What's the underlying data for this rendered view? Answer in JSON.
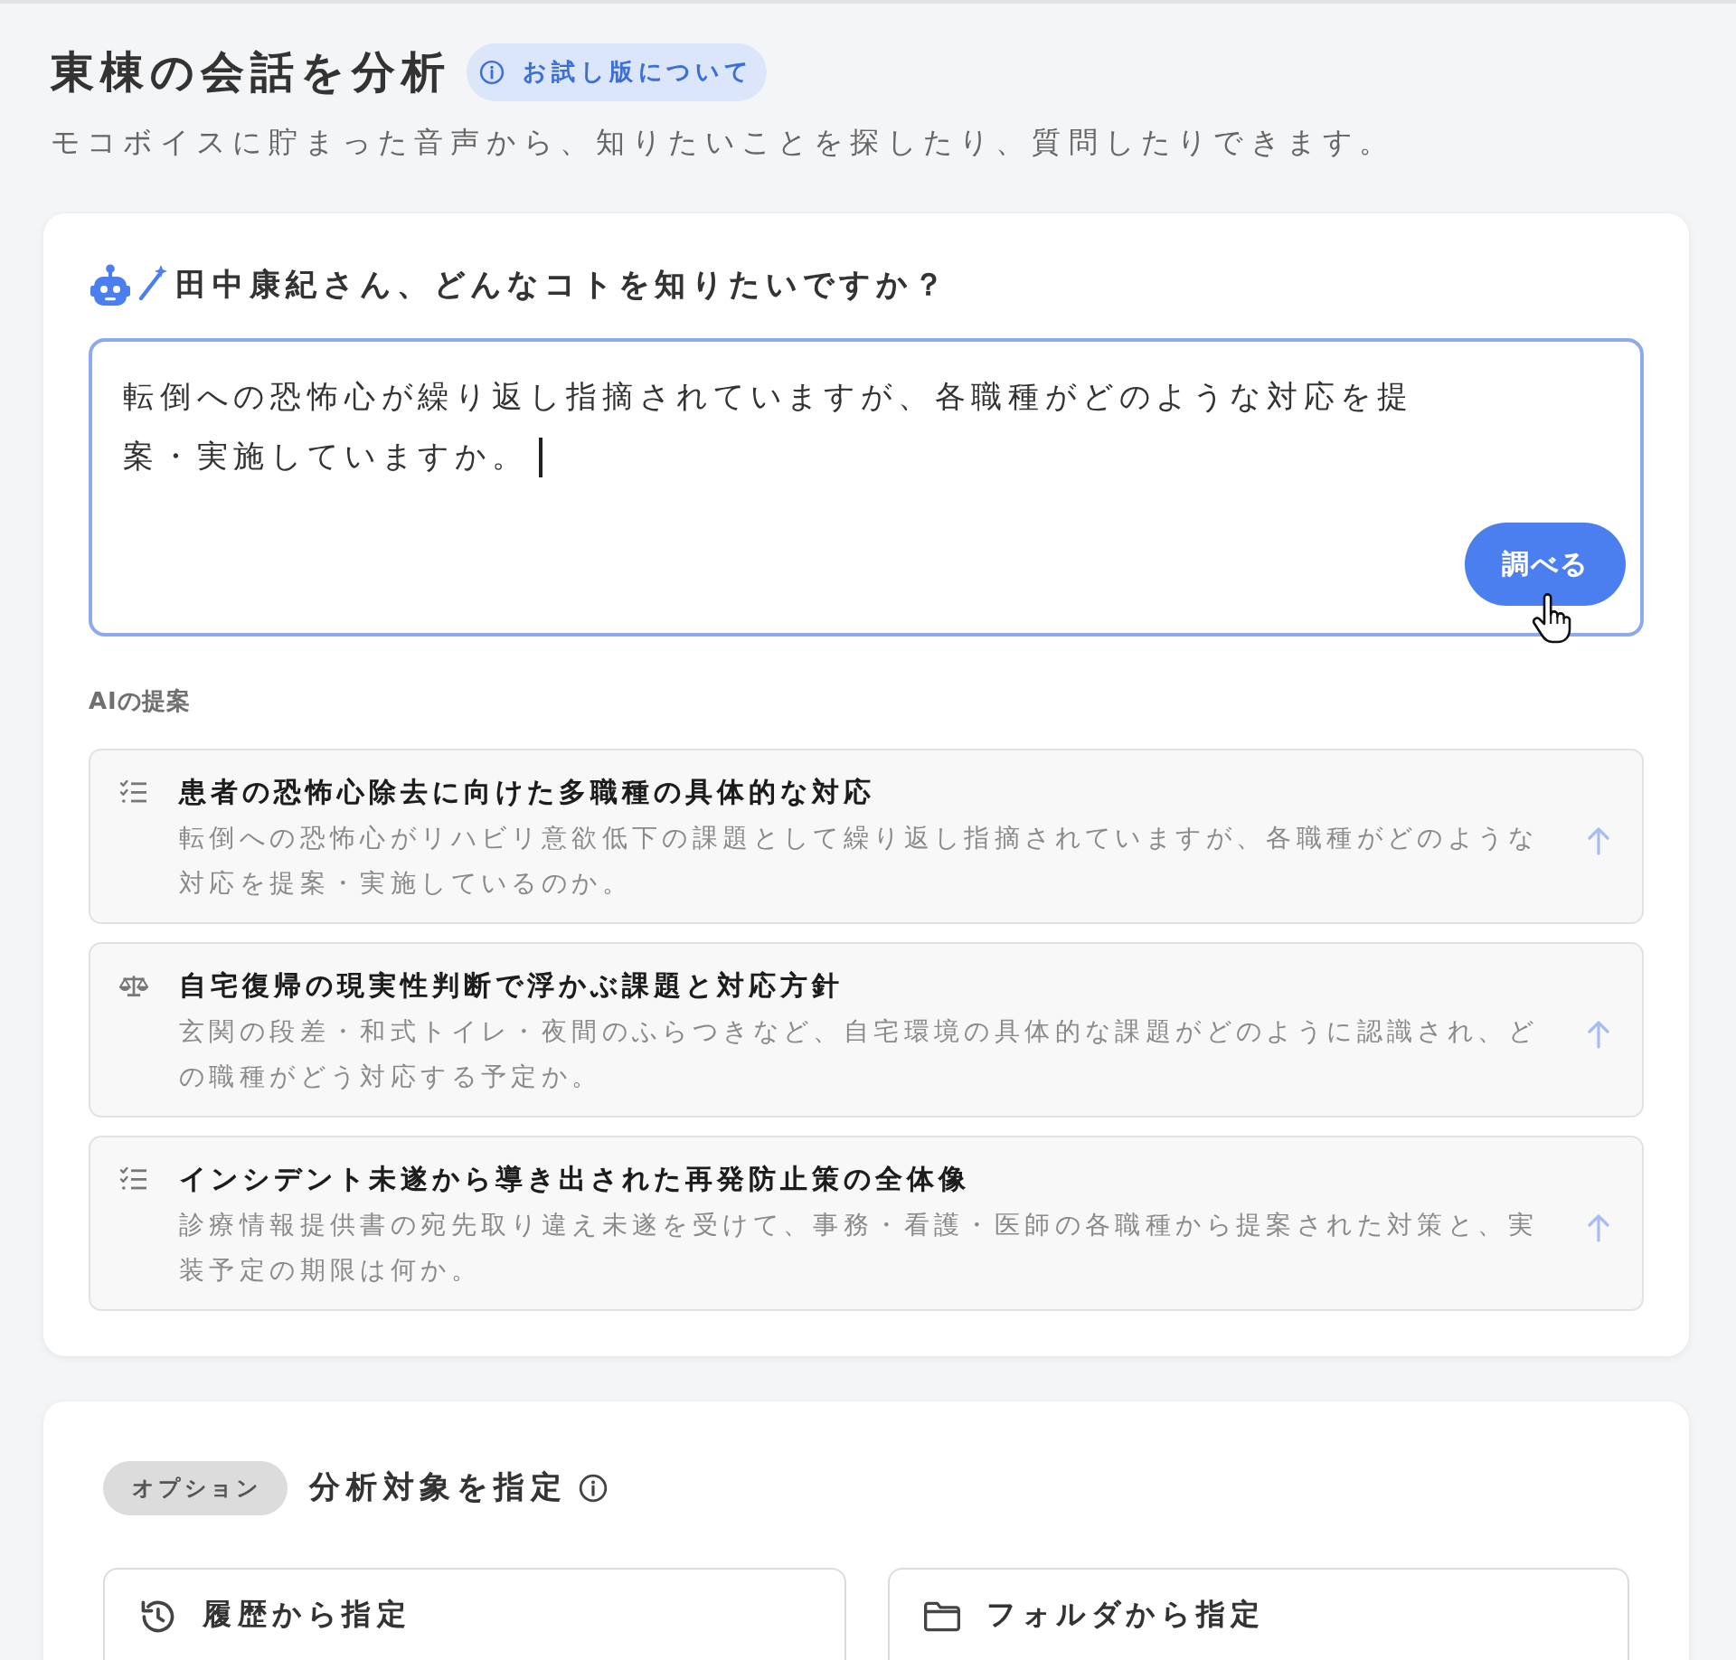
{
  "header": {
    "title": "東棟の会話を分析",
    "badge": "お試し版について",
    "subtitle": "モコボイスに貯まった音声から、知りたいことを探したり、質問したりできます。"
  },
  "question": {
    "prompt": "田中康紀さん、どんなコトを知りたいですか？",
    "value": "転倒への恐怖心が繰り返し指摘されていますが、各職種がどのような対応を提案・実施していますか。",
    "button": "調べる"
  },
  "suggestions": {
    "label": "AIの提案",
    "items": [
      {
        "kind": "checklist",
        "title": "患者の恐怖心除去に向けた多職種の具体的な対応",
        "description": "転倒への恐怖心がリハビリ意欲低下の課題として繰り返し指摘されていますが、各職種がどのような対応を提案・実施しているのか。"
      },
      {
        "kind": "balance",
        "title": "自宅復帰の現実性判断で浮かぶ課題と対応方針",
        "description": "玄関の段差・和式トイレ・夜間のふらつきなど、自宅環境の具体的な課題がどのように認識され、どの職種がどう対応する予定か。"
      },
      {
        "kind": "checklist",
        "title": "インシデント未遂から導き出された再発防止策の全体像",
        "description": "診療情報提供書の宛先取り違え未遂を受けて、事務・看護・医師の各職種から提案された対策と、実装予定の期限は何か。"
      }
    ]
  },
  "target": {
    "badge": "オプション",
    "title": "分析対象を指定",
    "options": [
      {
        "kind": "history",
        "label": "履歴から指定"
      },
      {
        "kind": "folder",
        "label": "フォルダから指定"
      }
    ]
  }
}
